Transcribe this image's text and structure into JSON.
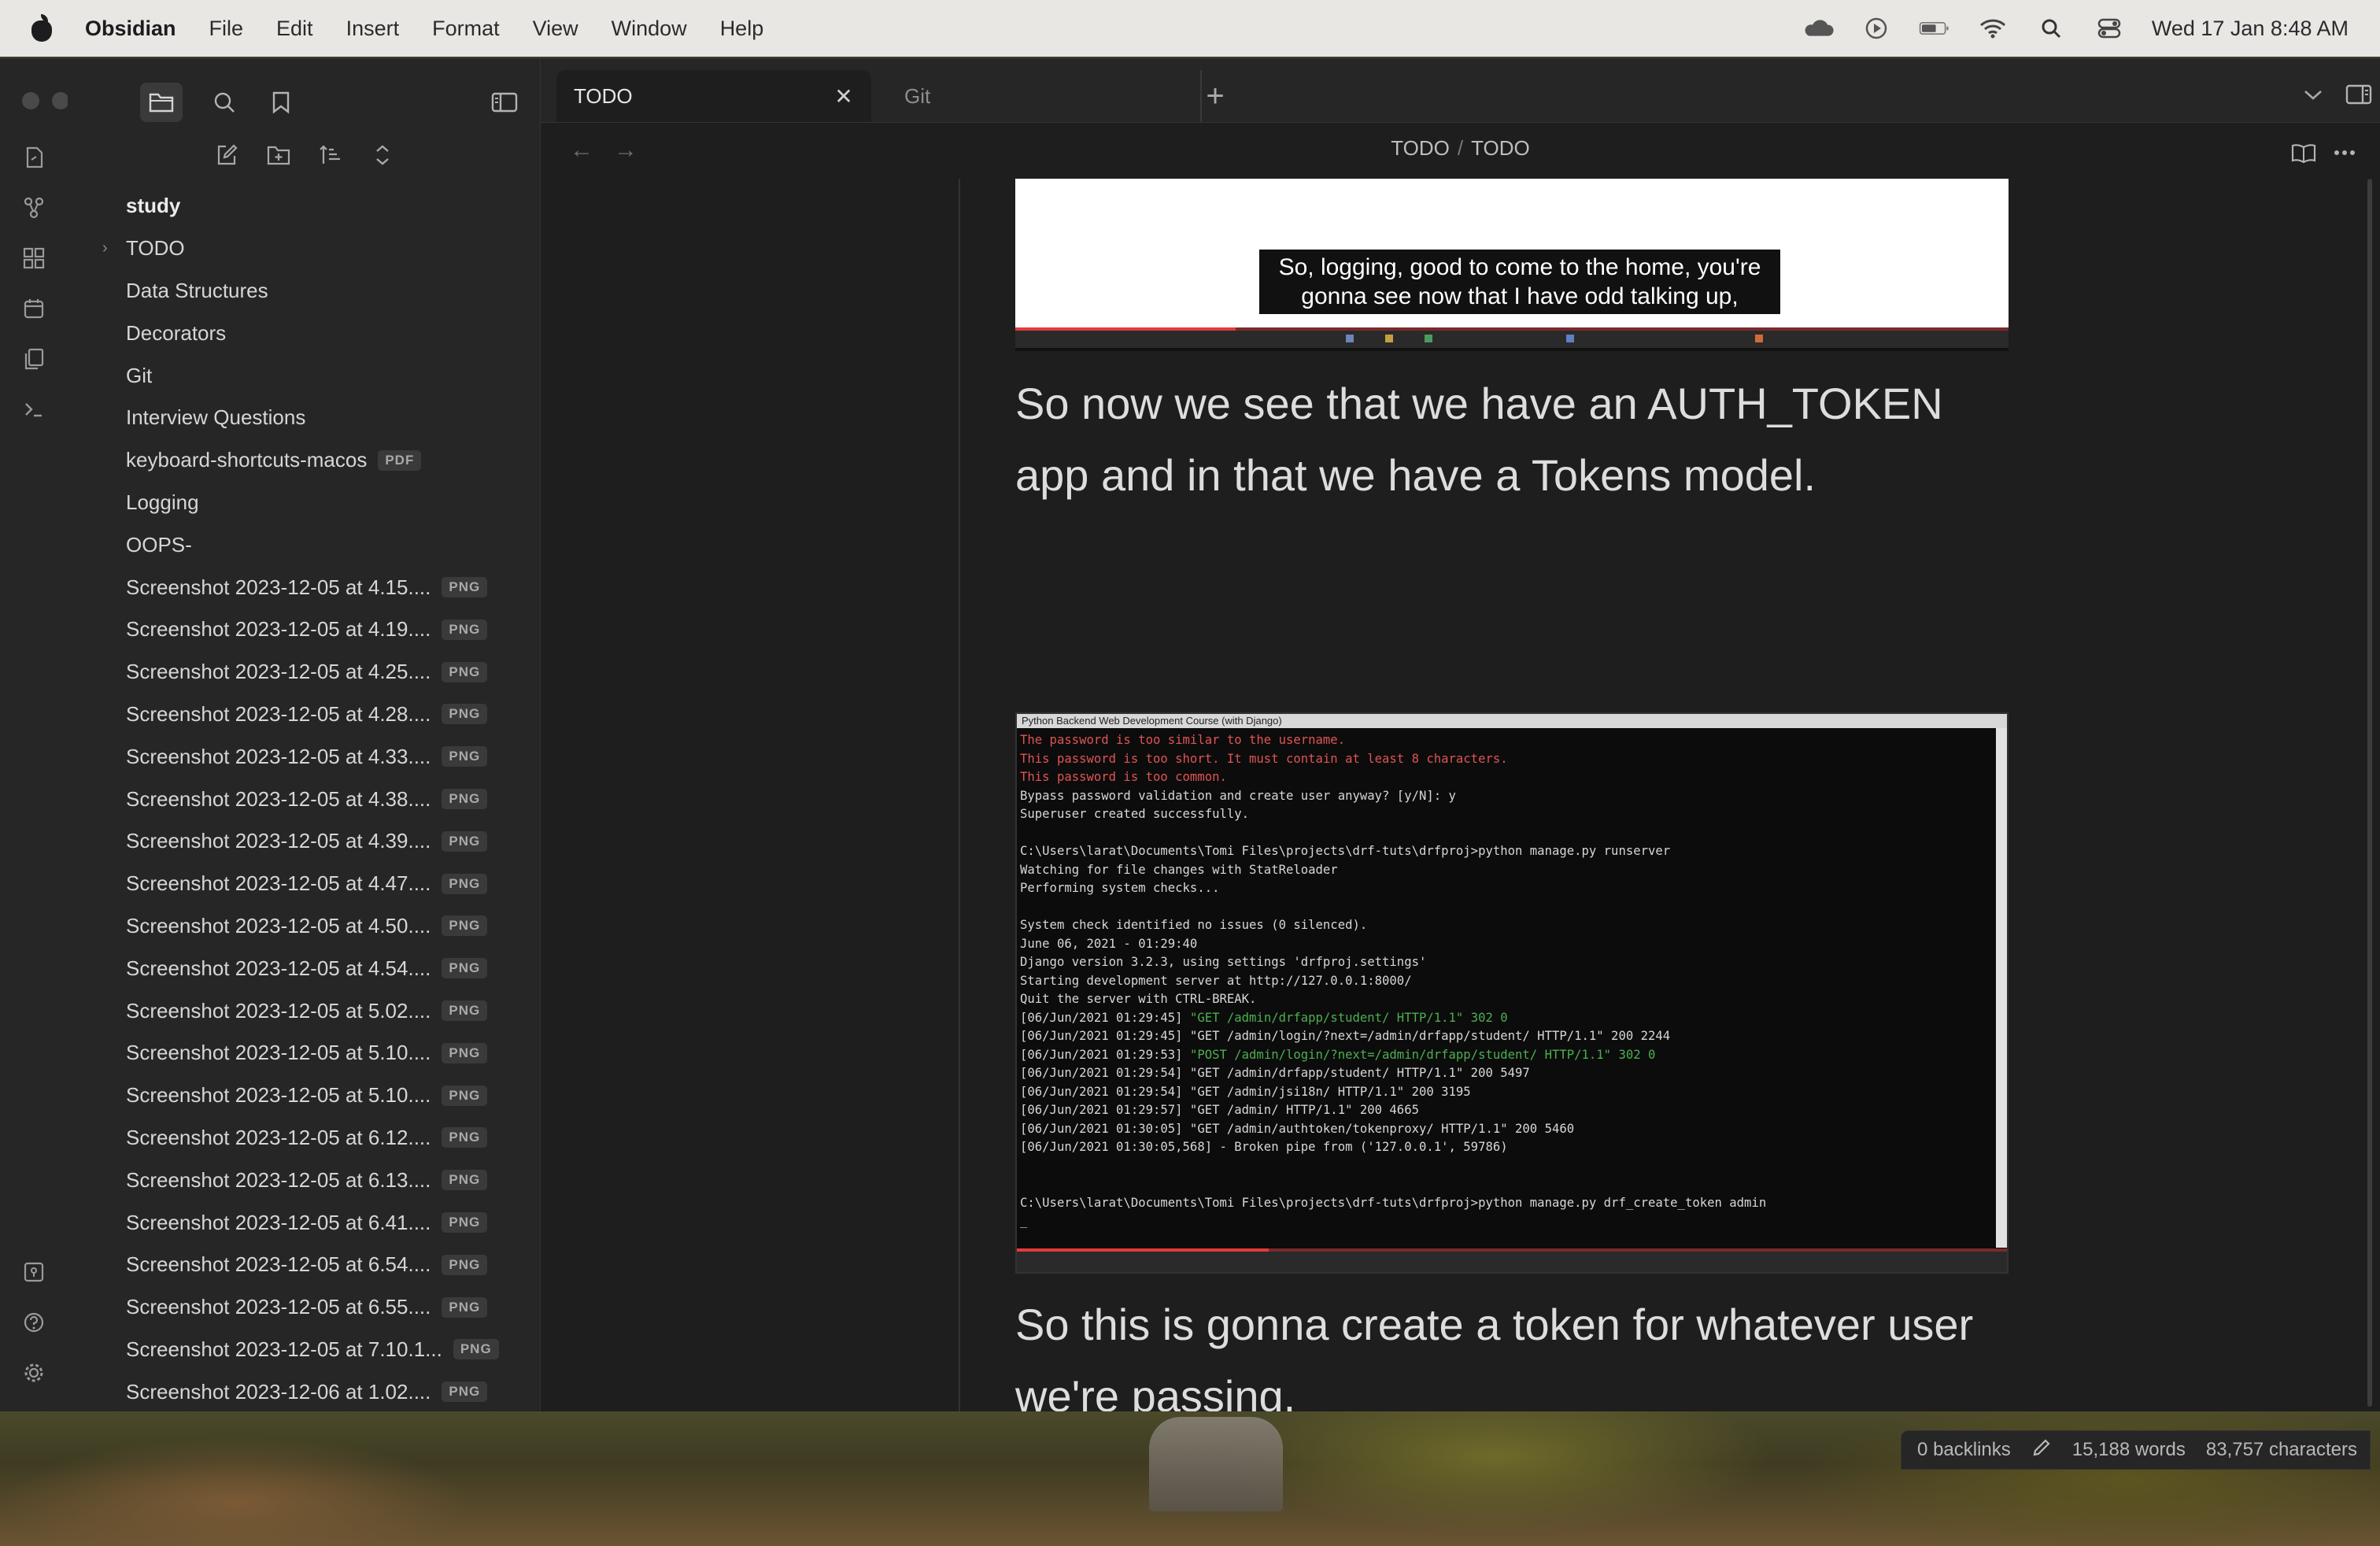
{
  "menubar": {
    "app": "Obsidian",
    "menus": [
      "File",
      "Edit",
      "Insert",
      "Format",
      "View",
      "Window",
      "Help"
    ],
    "status_icons": [
      "cloud-icon",
      "play-circle-icon",
      "battery-icon",
      "wifi-icon",
      "spotlight-search-icon",
      "control-center-icon"
    ],
    "clock": "Wed 17 Jan  8:48 AM"
  },
  "tabs": {
    "active": "TODO",
    "inactive": "Git"
  },
  "breadcrumb": {
    "parent": "TODO",
    "separator": "/",
    "current": "TODO"
  },
  "sidebar": {
    "root": "study",
    "items": [
      {
        "label": "TODO",
        "tag": "",
        "folder": true
      },
      {
        "label": "Data Structures",
        "tag": ""
      },
      {
        "label": "Decorators",
        "tag": ""
      },
      {
        "label": "Git",
        "tag": ""
      },
      {
        "label": "Interview Questions",
        "tag": ""
      },
      {
        "label": "keyboard-shortcuts-macos",
        "tag": "PDF"
      },
      {
        "label": "Logging",
        "tag": ""
      },
      {
        "label": "OOPS-",
        "tag": ""
      },
      {
        "label": "Screenshot 2023-12-05 at 4.15....",
        "tag": "PNG"
      },
      {
        "label": "Screenshot 2023-12-05 at 4.19....",
        "tag": "PNG"
      },
      {
        "label": "Screenshot 2023-12-05 at 4.25....",
        "tag": "PNG"
      },
      {
        "label": "Screenshot 2023-12-05 at 4.28....",
        "tag": "PNG"
      },
      {
        "label": "Screenshot 2023-12-05 at 4.33....",
        "tag": "PNG"
      },
      {
        "label": "Screenshot 2023-12-05 at 4.38....",
        "tag": "PNG"
      },
      {
        "label": "Screenshot 2023-12-05 at 4.39....",
        "tag": "PNG"
      },
      {
        "label": "Screenshot 2023-12-05 at 4.47....",
        "tag": "PNG"
      },
      {
        "label": "Screenshot 2023-12-05 at 4.50....",
        "tag": "PNG"
      },
      {
        "label": "Screenshot 2023-12-05 at 4.54....",
        "tag": "PNG"
      },
      {
        "label": "Screenshot 2023-12-05 at 5.02....",
        "tag": "PNG"
      },
      {
        "label": "Screenshot 2023-12-05 at 5.10....",
        "tag": "PNG"
      },
      {
        "label": "Screenshot 2023-12-05 at 5.10....",
        "tag": "PNG"
      },
      {
        "label": "Screenshot 2023-12-05 at 6.12....",
        "tag": "PNG"
      },
      {
        "label": "Screenshot 2023-12-05 at 6.13....",
        "tag": "PNG"
      },
      {
        "label": "Screenshot 2023-12-05 at 6.41....",
        "tag": "PNG"
      },
      {
        "label": "Screenshot 2023-12-05 at 6.54....",
        "tag": "PNG"
      },
      {
        "label": "Screenshot 2023-12-05 at 6.55....",
        "tag": "PNG"
      },
      {
        "label": "Screenshot 2023-12-05 at 7.10.1...",
        "tag": "PNG"
      },
      {
        "label": "Screenshot 2023-12-06 at 1.02....",
        "tag": "PNG"
      }
    ]
  },
  "editor": {
    "image1_caption_line1": "So, logging, good to come to the home, you're",
    "image1_caption_line2": "gonna see now that I have odd talking up,",
    "para1": "So now we see that we have an AUTH_TOKEN app and in that we have a Tokens model.",
    "image2_title": "Python Backend Web Development Course (with Django)",
    "terminal": [
      {
        "t": "The password is too similar to the username.",
        "c": "red"
      },
      {
        "t": "This password is too short. It must contain at least 8 characters.",
        "c": "red"
      },
      {
        "t": "This password is too common.",
        "c": "red"
      },
      {
        "t": "Bypass password validation and create user anyway? [y/N]: y",
        "c": ""
      },
      {
        "t": "Superuser created successfully.",
        "c": ""
      },
      {
        "t": "",
        "c": ""
      },
      {
        "t": "C:\\Users\\larat\\Documents\\Tomi Files\\projects\\drf-tuts\\drfproj>python manage.py runserver",
        "c": ""
      },
      {
        "t": "Watching for file changes with StatReloader",
        "c": ""
      },
      {
        "t": "Performing system checks...",
        "c": ""
      },
      {
        "t": "",
        "c": ""
      },
      {
        "t": "System check identified no issues (0 silenced).",
        "c": ""
      },
      {
        "t": "June 06, 2021 - 01:29:40",
        "c": ""
      },
      {
        "t": "Django version 3.2.3, using settings 'drfproj.settings'",
        "c": ""
      },
      {
        "t": "Starting development server at http://127.0.0.1:8000/",
        "c": ""
      },
      {
        "t": "Quit the server with CTRL-BREAK.",
        "c": ""
      },
      {
        "t": "[06/Jun/2021 01:29:45] ",
        "c": "",
        "g": "\"GET /admin/drfapp/student/ HTTP/1.1\" 302 0"
      },
      {
        "t": "[06/Jun/2021 01:29:45] \"GET /admin/login/?next=/admin/drfapp/student/ HTTP/1.1\" 200 2244",
        "c": ""
      },
      {
        "t": "[06/Jun/2021 01:29:53] ",
        "c": "",
        "g": "\"POST /admin/login/?next=/admin/drfapp/student/ HTTP/1.1\" 302 0"
      },
      {
        "t": "[06/Jun/2021 01:29:54] \"GET /admin/drfapp/student/ HTTP/1.1\" 200 5497",
        "c": ""
      },
      {
        "t": "[06/Jun/2021 01:29:54] \"GET /admin/jsi18n/ HTTP/1.1\" 200 3195",
        "c": ""
      },
      {
        "t": "[06/Jun/2021 01:29:57] \"GET /admin/ HTTP/1.1\" 200 4665",
        "c": ""
      },
      {
        "t": "[06/Jun/2021 01:30:05] \"GET /admin/authtoken/tokenproxy/ HTTP/1.1\" 200 5460",
        "c": ""
      },
      {
        "t": "[06/Jun/2021 01:30:05,568] - Broken pipe from ('127.0.0.1', 59786)",
        "c": ""
      },
      {
        "t": "",
        "c": ""
      },
      {
        "t": "",
        "c": ""
      },
      {
        "t": "C:\\Users\\larat\\Documents\\Tomi Files\\projects\\drf-tuts\\drfproj>python manage.py drf_create_token admin",
        "c": ""
      },
      {
        "t": "_",
        "c": ""
      }
    ],
    "para2": "So this is gonna create a token for whatever user we're passing."
  },
  "statusbar": {
    "backlinks": "0 backlinks",
    "words": "15,188 words",
    "characters": "83,757 characters"
  },
  "colors": {
    "background": "#1e1e1e",
    "sidebar": "#262626",
    "menubar": "#e9e7e4",
    "terminal_red": "#e05454",
    "terminal_green": "#4caf50"
  }
}
